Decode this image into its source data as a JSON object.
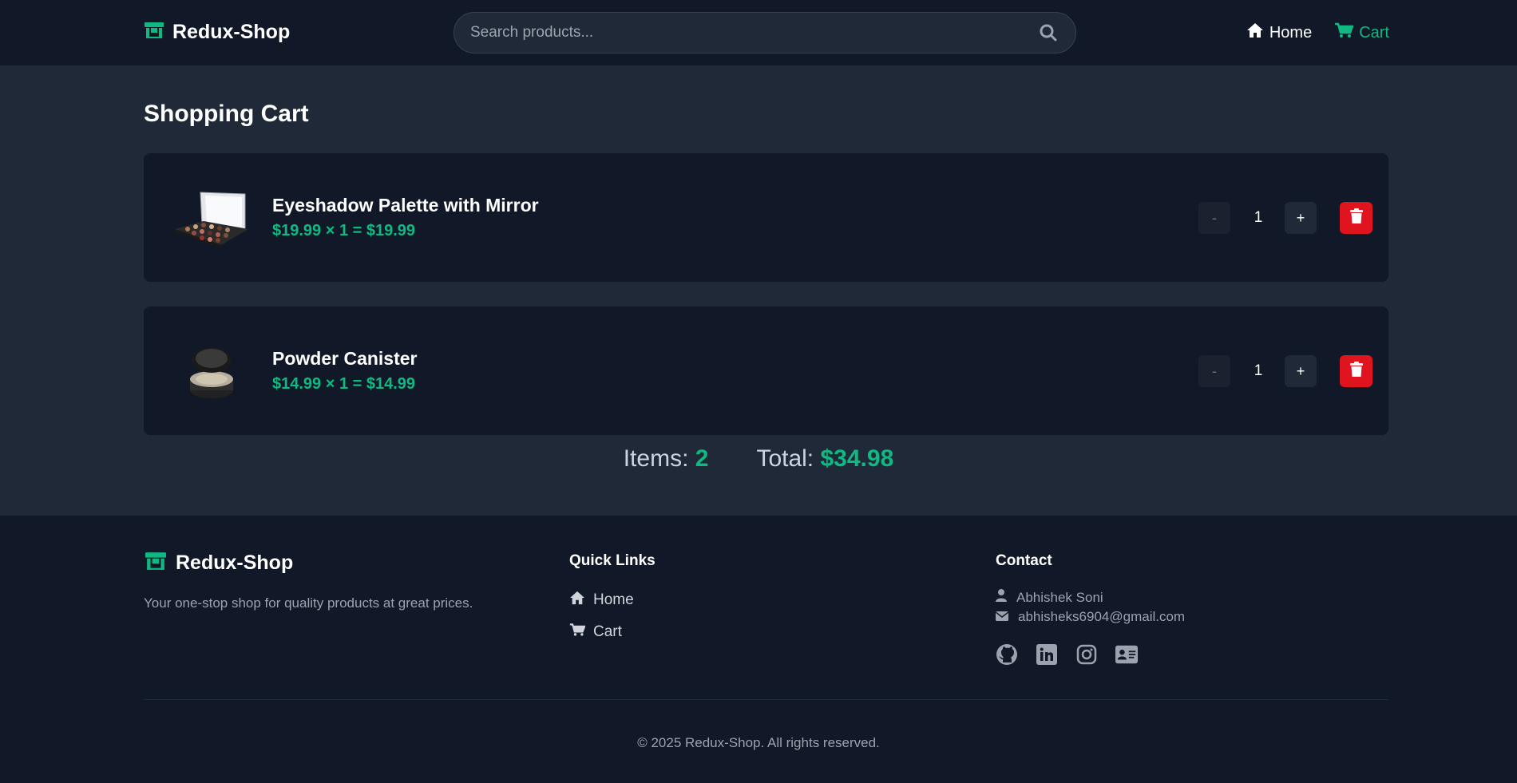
{
  "app": {
    "name": "Redux-Shop"
  },
  "header": {
    "search_placeholder": "Search products...",
    "nav": [
      {
        "label": "Home",
        "icon": "home-icon"
      },
      {
        "label": "Cart",
        "icon": "cart-icon",
        "active": true
      }
    ]
  },
  "main": {
    "title": "Shopping Cart",
    "items": [
      {
        "name": "Eyeshadow Palette with Mirror",
        "price_line": "$19.99 × 1 = $19.99",
        "quantity": "1",
        "minus_label": "-",
        "plus_label": "+"
      },
      {
        "name": "Powder Canister",
        "price_line": "$14.99 × 1 = $14.99",
        "quantity": "1",
        "minus_label": "-",
        "plus_label": "+"
      }
    ],
    "summary": {
      "items_label": "Items:",
      "items_value": "2",
      "total_label": "Total:",
      "total_value": "$34.98"
    }
  },
  "footer": {
    "brand": "Redux-Shop",
    "tagline": "Your one-stop shop for quality products at great prices.",
    "quick_links_heading": "Quick Links",
    "quick_links": [
      {
        "label": "Home"
      },
      {
        "label": "Cart"
      }
    ],
    "contact_heading": "Contact",
    "contact_name": "Abhishek Soni",
    "contact_email": "abhisheks6904@gmail.com",
    "socials": [
      "github-icon",
      "linkedin-icon",
      "instagram-icon",
      "contact-card-icon"
    ],
    "copyright": "© 2025 Redux-Shop. All rights reserved."
  },
  "colors": {
    "accent": "#10b981",
    "danger": "#e0141e",
    "background": "#1f2937",
    "surface": "#111827"
  }
}
